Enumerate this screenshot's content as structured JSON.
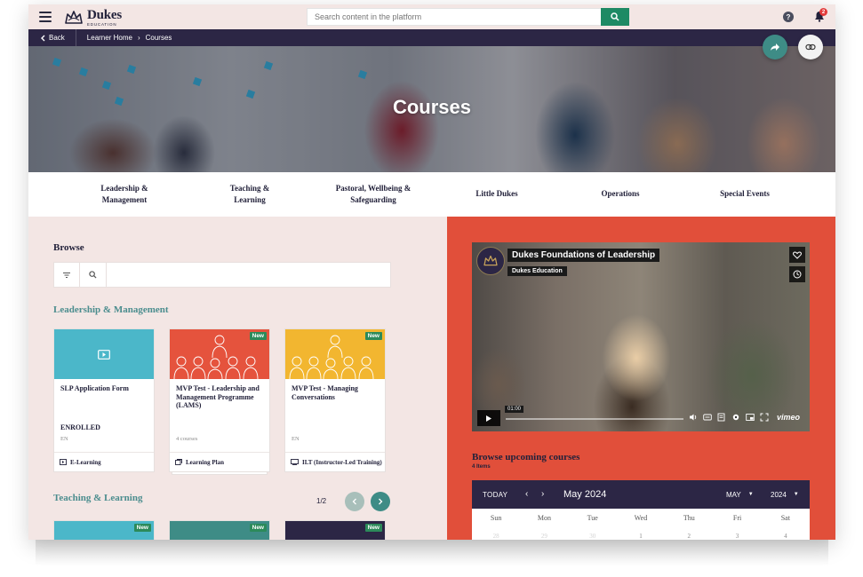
{
  "header": {
    "logo_name": "Dukes",
    "logo_sub": "EDUCATION",
    "search_placeholder": "Search content in the platform",
    "notifications_count": "2"
  },
  "breadcrumb": {
    "back": "Back",
    "items": [
      "Learner Home",
      "Courses"
    ]
  },
  "hero": {
    "title": "Courses"
  },
  "categories": [
    "Leadership & Management",
    "Teaching & Learning",
    "Pastoral, Wellbeing & Safeguarding",
    "Little Dukes",
    "Operations",
    "Special Events"
  ],
  "browse": {
    "title": "Browse",
    "sections": [
      {
        "title": "Leadership & Management",
        "cards": [
          {
            "title": "SLP Application Form",
            "status": "ENROLLED",
            "meta": "EN",
            "type": "E-Learning",
            "new": "",
            "color": "#4bb7c9"
          },
          {
            "title": "MVP Test - Leadership and Management Programme (LAMS)",
            "status": "",
            "meta": "4 courses",
            "type": "Learning Plan",
            "new": "New",
            "color": "#e5533d"
          },
          {
            "title": "MVP Test - Managing Conversations",
            "status": "",
            "meta": "EN",
            "type": "ILT (Instructor-Led Training)",
            "new": "New",
            "color": "#f2b630"
          }
        ]
      },
      {
        "title": "Teaching & Learning",
        "pager": "1/2",
        "cards": [
          {
            "new": "New",
            "color": "#4bb7c9"
          },
          {
            "new": "New",
            "color": "#3e8c86"
          },
          {
            "new": "New",
            "color": "#2c2645"
          }
        ]
      }
    ]
  },
  "video": {
    "title": "Dukes Foundations of Leadership",
    "subtitle": "Dukes Education",
    "time": "01:00",
    "brand": "vimeo"
  },
  "upcoming": {
    "title": "Browse upcoming courses",
    "count": "4 Items",
    "today": "TODAY",
    "month_label": "May 2024",
    "month_select": "MAY",
    "year_select": "2024",
    "weekdays": [
      "Sun",
      "Mon",
      "Tue",
      "Wed",
      "Thu",
      "Fri",
      "Sat"
    ],
    "first_row": [
      "28",
      "29",
      "30",
      "1",
      "2",
      "3",
      "4"
    ]
  },
  "colors": {
    "navy": "#2c2645",
    "accent_green": "#1e8a64",
    "teal": "#3e8c86",
    "coral": "#e14f3a",
    "blush": "#f3e6e4"
  }
}
